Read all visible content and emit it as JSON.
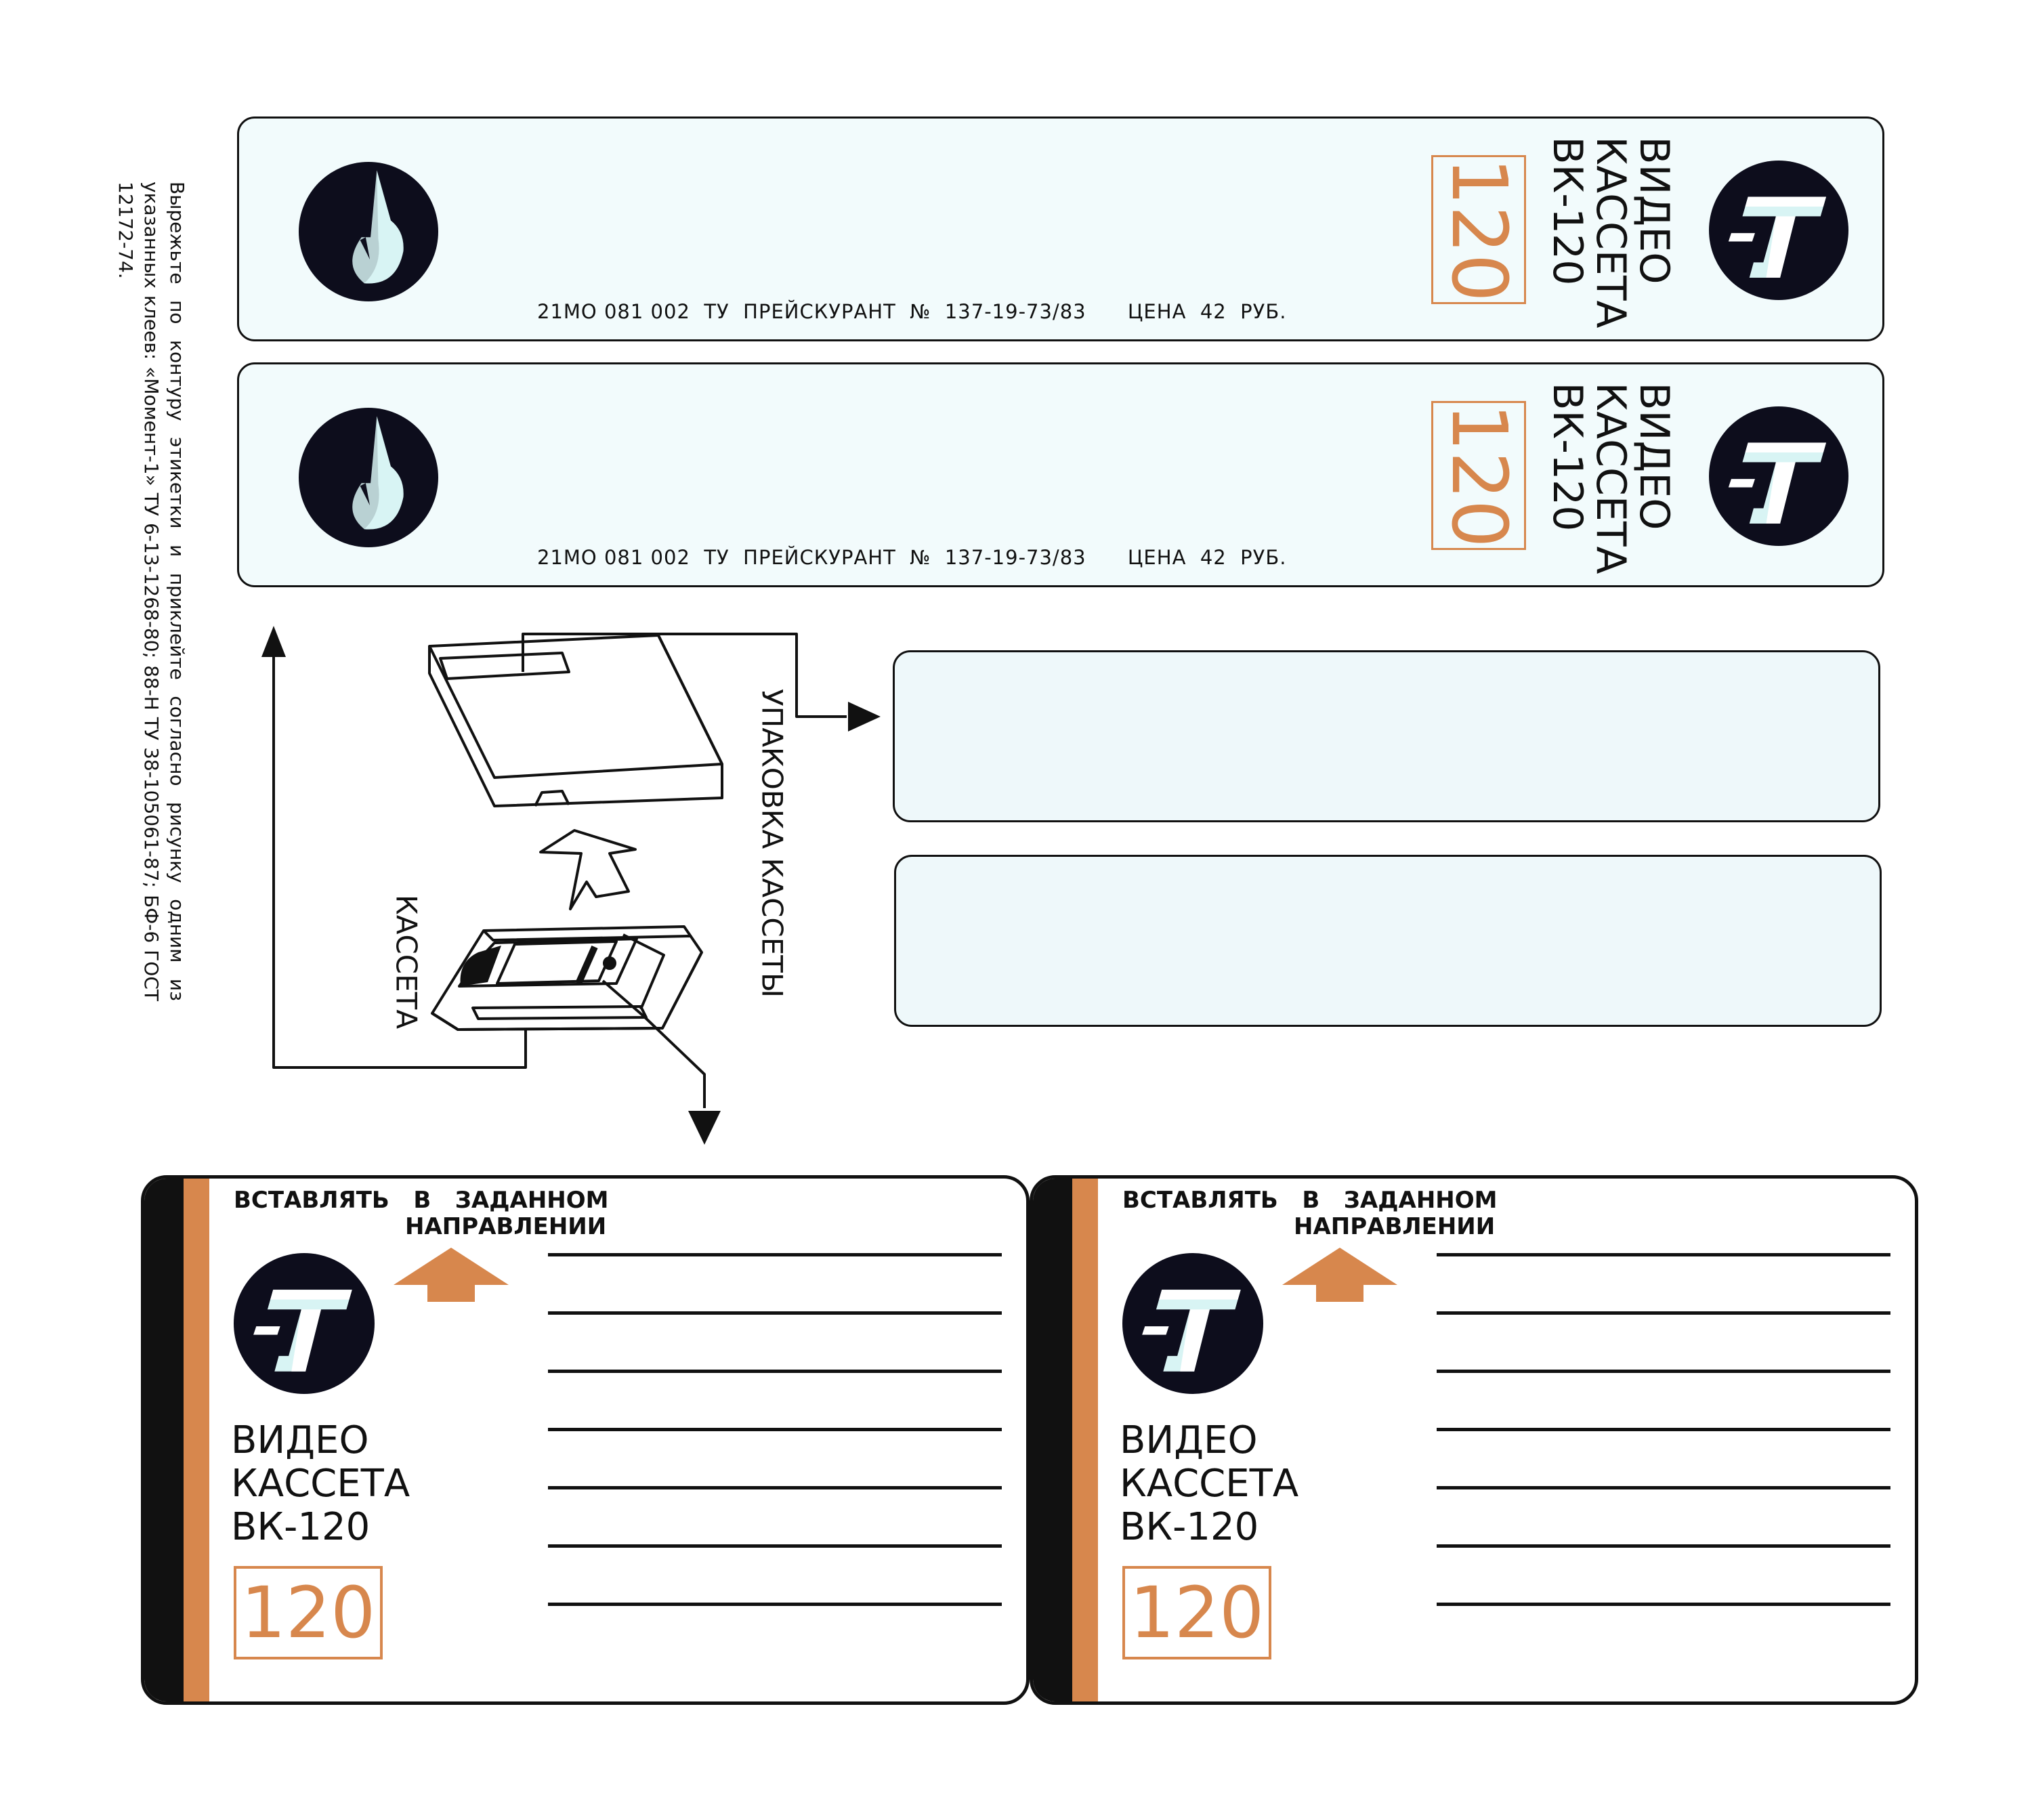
{
  "spines": [
    {
      "code": "21МО 081 002  ТУ  ПРЕЙСКУРАНТ  №  137-19-73/83",
      "price": "ЦЕНА  42  РУБ.",
      "number": "120",
      "title": [
        "ВИДЕО",
        "КАССЕТА",
        "ВК-120"
      ]
    },
    {
      "code": "21МО 081 002  ТУ  ПРЕЙСКУРАНТ  №  137-19-73/83",
      "price": "ЦЕНА  42  РУБ.",
      "number": "120",
      "title": [
        "ВИДЕО",
        "КАССЕТА",
        "ВК-120"
      ]
    }
  ],
  "side_note": "Вырежьте  по  контуру  этикетки  и  приклейте  согласно  рисунку одним из указанных клеев: «Момент-1» ТУ 6-13-1268-80; 88-Н ТУ 38-105061-87; БФ-6 ГОСТ 12172-74.",
  "diagram": {
    "package_label": "УПАКОВКА КАССЕТЫ",
    "cassette_label": "КАССЕТА"
  },
  "cards": [
    {
      "insert_line1": "ВСТАВЛЯТЬ   В   ЗАДАННОМ",
      "insert_line2": "НАПРАВЛЕНИИ",
      "title": [
        "ВИДЕО",
        "КАССЕТА",
        "ВК-120"
      ],
      "number": "120"
    },
    {
      "insert_line1": "ВСТАВЛЯТЬ   В   ЗАДАННОМ",
      "insert_line2": "НАПРАВЛЕНИИ",
      "title": [
        "ВИДЕО",
        "КАССЕТА",
        "ВК-120"
      ],
      "number": "120"
    }
  ],
  "colors": {
    "accent": "#d7874d",
    "label_bg": "#f2fbfc",
    "logo_dark": "#0d0d1c",
    "logo_light": "#d8f4f4"
  }
}
